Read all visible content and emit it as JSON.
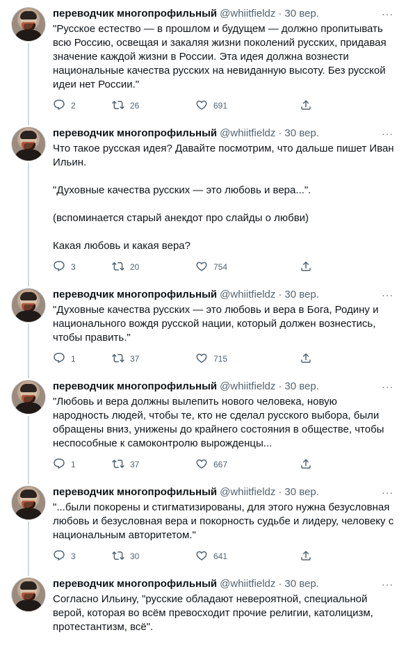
{
  "author": {
    "name": "переводчик многопрофильный",
    "handle": "@whiitfieldz",
    "separator": "·",
    "more_icon": "more-dots-icon"
  },
  "tweets": [
    {
      "date": "30 вер.",
      "text": "\"Русское естество — в прошлом и будущем — должно пропитывать всю Россию, освещая и закаляя жизни поколений русских, придавая значение каждой жизни в России. Эта идея должна вознести национальные качества русских на невиданную высоту. Без русской идеи нет России.\"",
      "replies": "2",
      "retweets": "26",
      "likes": "691"
    },
    {
      "date": "30 вер.",
      "text": "Что такое русская идея? Давайте посмотрим, что дальше пишет Иван Ильин.\n\n\"Духовные качества русских — это любовь и вера...\".\n\n(вспоминается старый анекдот про слайды о любви)\n\nКакая любовь и какая вера?",
      "replies": "3",
      "retweets": "20",
      "likes": "754"
    },
    {
      "date": "30 вер.",
      "text": "\"Духовные качества русских — это любовь и вера в Бога, Родину и национального вождя русской нации, который должен вознестись, чтобы править.\"",
      "replies": "1",
      "retweets": "37",
      "likes": "715"
    },
    {
      "date": "30 вер.",
      "text": "\"Любовь и вера должны вылепить нового человека, новую народность людей, чтобы те, кто не сделал русского выбора, были обращены вниз, унижены до крайнего состояния в обществе, чтобы неспособные к самоконтролю вырожденцы...",
      "replies": "1",
      "retweets": "37",
      "likes": "667"
    },
    {
      "date": "30 вер.",
      "text": "\"...были покорены и стигматизированы, для этого нужна безусловная любовь и безусловная вера и покорность судьбе и лидеру, человеку с национальным авторитетом.\"",
      "replies": "3",
      "retweets": "30",
      "likes": "641"
    },
    {
      "date": "30 вер.",
      "text": "Согласно Ильину, \"русские обладают невероятной, специальной верой, которая во всём превосходит прочие религии, католицизм, протестантизм, всё\".",
      "replies": "",
      "retweets": "",
      "likes": ""
    }
  ],
  "colors": {
    "text": "#0f1419",
    "muted": "#536471",
    "thread_line": "#cfd9de"
  }
}
